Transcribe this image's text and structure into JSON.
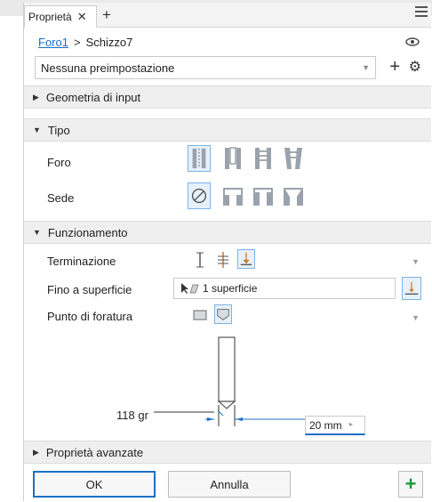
{
  "tab": {
    "title": "Proprietà",
    "close": "✕",
    "add": "+"
  },
  "breadcrumb": {
    "feature": "Foro1",
    "separator": ">",
    "sketch": "Schizzo7"
  },
  "preset": {
    "value": "Nessuna preimpostazione",
    "add": "+",
    "gear": "⚙"
  },
  "sections": {
    "input_geometry": "Geometria di input",
    "type": "Tipo",
    "behavior": "Funzionamento",
    "advanced": "Proprietà avanzate"
  },
  "type": {
    "hole_label": "Foro",
    "seat_label": "Sede",
    "hole_options": [
      "simple-hole-icon",
      "clearance-hole-icon",
      "tapped-hole-icon",
      "taper-tapped-hole-icon"
    ],
    "seat_options": [
      "no-seat-icon",
      "counterbore-icon",
      "spotface-icon",
      "countersink-icon"
    ]
  },
  "behavior": {
    "termination_label": "Terminazione",
    "termination_options": [
      "distance-icon",
      "through-all-icon",
      "to-surface-icon"
    ],
    "to_surface_label": "Fino a superficie",
    "to_surface_value": "1 superficie",
    "drill_point_label": "Punto di foratura",
    "drill_point_options": [
      "flat-point-icon",
      "angle-point-icon"
    ]
  },
  "preview": {
    "angle": "118 gr",
    "distance": "20 mm",
    "spin": "▸"
  },
  "buttons": {
    "ok": "OK",
    "cancel": "Annulla",
    "add": "+"
  },
  "colors": {
    "accent": "#1a6fc7",
    "selected_bg": "#e6f1fb",
    "section_bg": "#efefef",
    "ok_add": "#1a9b3c"
  }
}
